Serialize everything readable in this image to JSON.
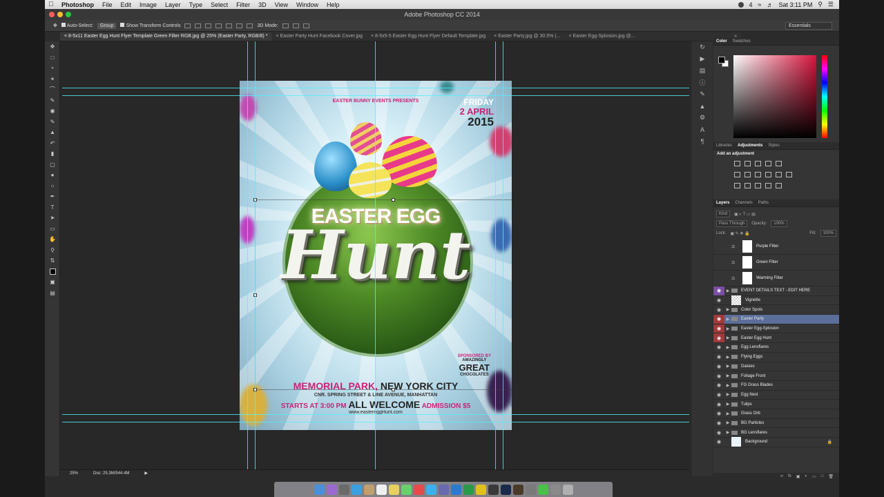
{
  "menubar": {
    "app": "Photoshop",
    "items": [
      "File",
      "Edit",
      "Image",
      "Layer",
      "Type",
      "Select",
      "Filter",
      "3D",
      "View",
      "Window",
      "Help"
    ],
    "clock": "Sat 3:11 PM",
    "battery_count": "4"
  },
  "window": {
    "title": "Adobe Photoshop CC 2014"
  },
  "options": {
    "auto_select_label": "Auto-Select:",
    "auto_select_value": "Group",
    "transform_label": "Show Transform Controls",
    "mode_3d": "3D Mode:",
    "workspace": "Essentials"
  },
  "tabs": [
    "8-5x11 Easter Egg Hunt Flyer Template Green Filter RGB.jpg @ 25% (Easter Party, RGB/8) *",
    "Easter Party Hunt Facebook Cover.jpg",
    "8-5x5-5 Easter Egg Hunt Flyer Default Template.jpg",
    "Easter Party.jpg @ 30.5% (...",
    "Easter Egg-Splosion.jpg @..."
  ],
  "poster": {
    "presents": "EASTER BUNNY EVENTS PRESENTS",
    "day": "FRIDAY",
    "date": "2 APRIL",
    "year": "2015",
    "headline": "EASTER EGG",
    "script": "Hunt",
    "sponsor_label": "SPONSORED BY",
    "sponsor_line1": "AMAZINGLY",
    "sponsor_line2": "GREAT",
    "sponsor_line3": "CHOCOLATES",
    "venue": "MEMORIAL PARK,",
    "city": "NEW YORK CITY",
    "address": "CNR. SPRING STREET & LINE AVENUE, MANHATTAN",
    "starts": "STARTS AT 3:00 PM",
    "welcome": "ALL WELCOME",
    "admission": "ADMISSION $5",
    "url": "www.eastereggHunt.com"
  },
  "status": {
    "zoom": "25%",
    "doc": "Doc: 25.3M/544.4M"
  },
  "panels": {
    "color_tabs": [
      "Color",
      "Swatches"
    ],
    "adj_tabs": [
      "Libraries",
      "Adjustments",
      "Styles"
    ],
    "adj_title": "Add an adjustment",
    "layer_tabs": [
      "Layers",
      "Channels",
      "Paths"
    ],
    "kind": "Kind",
    "blend": "Pass Through",
    "opacity_label": "Opacity:",
    "opacity_value": "100%",
    "lock_label": "Lock:",
    "fill_label": "Fill:",
    "fill_value": "100%"
  },
  "layers": [
    {
      "name": "Purple Filter",
      "type": "adj"
    },
    {
      "name": "Green Filter",
      "type": "adj"
    },
    {
      "name": "Warming Filter",
      "type": "adj"
    },
    {
      "name": "EVENT DETAILS TEXT - EDIT HERE",
      "type": "group",
      "eye": "purple"
    },
    {
      "name": "Vignette",
      "type": "pixel"
    },
    {
      "name": "Color Spots",
      "type": "group"
    },
    {
      "name": "Easter Party",
      "type": "group",
      "eye": "red",
      "selected": true
    },
    {
      "name": "Easter Egg-Splosion",
      "type": "group",
      "eye": "red"
    },
    {
      "name": "Easter Egg Hunt",
      "type": "group",
      "eye": "red"
    },
    {
      "name": "Egg Lensflares",
      "type": "group"
    },
    {
      "name": "Flying Eggs",
      "type": "group"
    },
    {
      "name": "Daisies",
      "type": "group"
    },
    {
      "name": "Foliage Front",
      "type": "group"
    },
    {
      "name": "FG Grass Blades",
      "type": "group"
    },
    {
      "name": "Egg Nest",
      "type": "group"
    },
    {
      "name": "Tulips",
      "type": "group"
    },
    {
      "name": "Grass Orb",
      "type": "group"
    },
    {
      "name": "BG Particles",
      "type": "group"
    },
    {
      "name": "BG Lensflares",
      "type": "group"
    },
    {
      "name": "Background",
      "type": "bg"
    }
  ],
  "colors": {
    "accent": "#cc2277",
    "guide": "#4ff0ff",
    "selection": "#5c6e9a"
  }
}
